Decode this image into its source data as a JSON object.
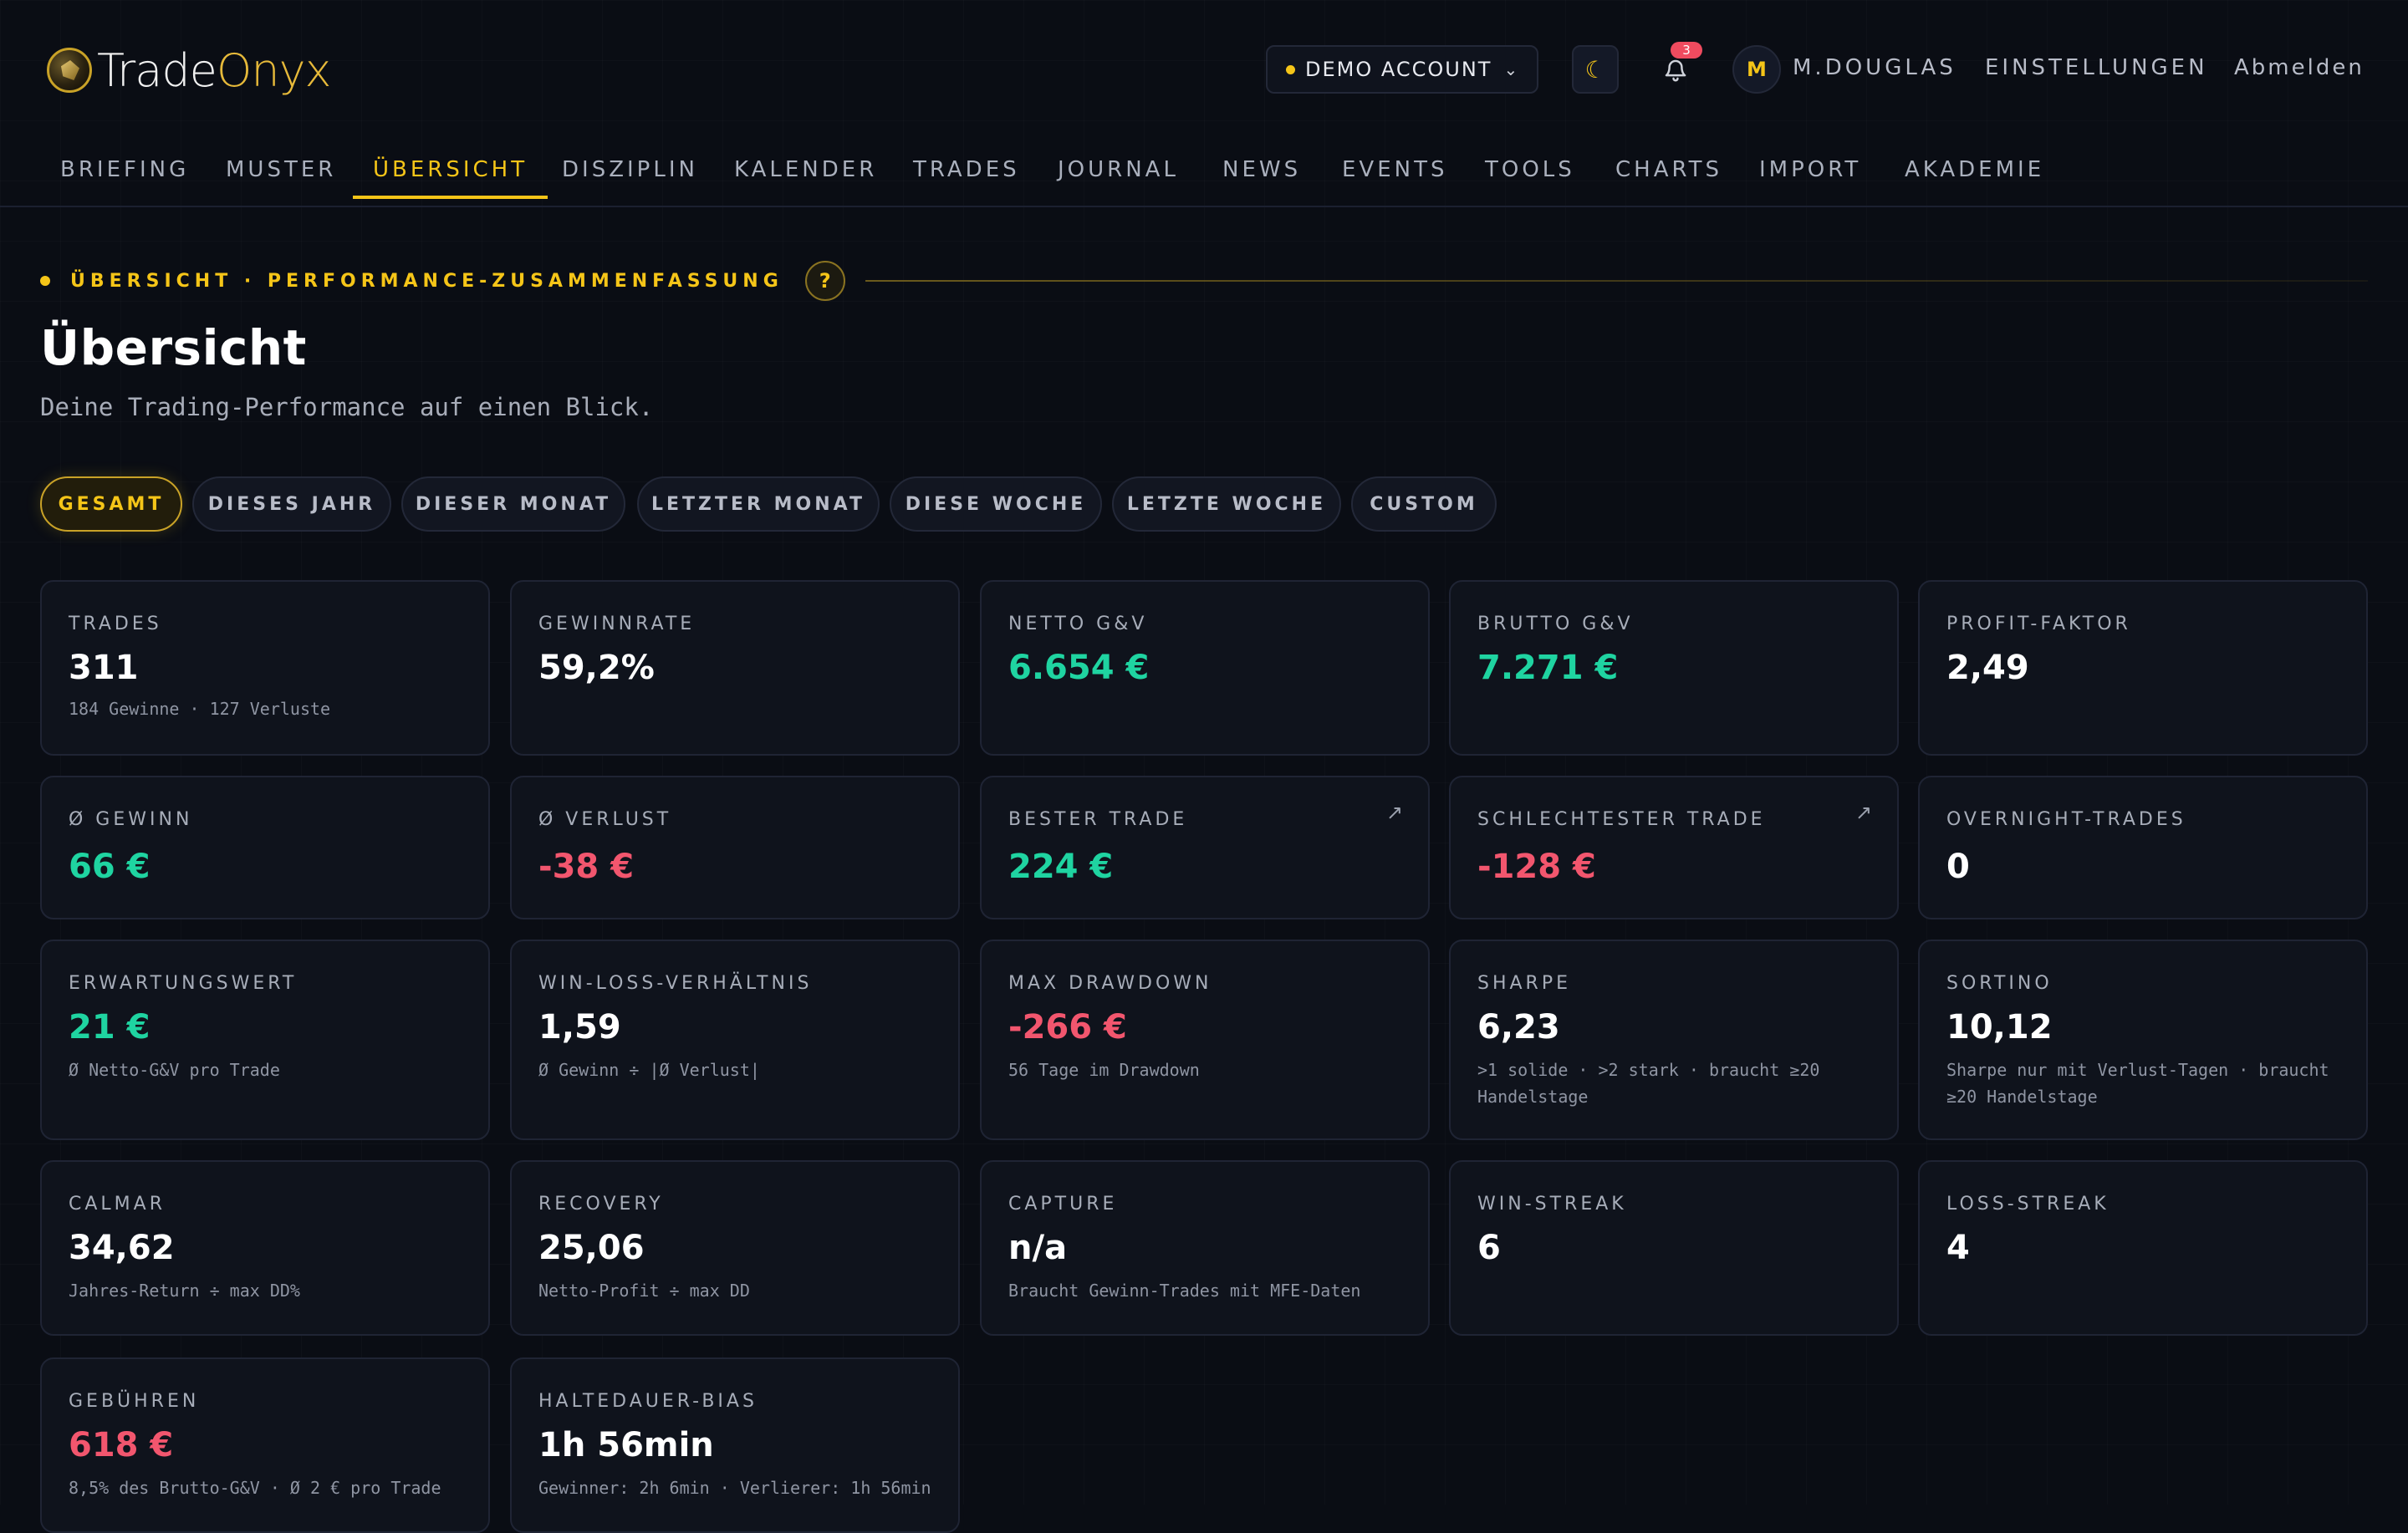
{
  "brand": {
    "name_a": "Trade",
    "name_b": "Onyx"
  },
  "header": {
    "account_label": "DEMO ACCOUNT",
    "notification_count": "3",
    "avatar_initial": "M",
    "user_name": "M.DOUGLAS",
    "settings_label": "EINSTELLUNGEN",
    "logout_label": "Abmelden"
  },
  "nav": {
    "tabs": [
      {
        "label": "BRIEFING"
      },
      {
        "label": "MUSTER"
      },
      {
        "label": "ÜBERSICHT"
      },
      {
        "label": "DISZIPLIN"
      },
      {
        "label": "KALENDER"
      },
      {
        "label": "TRADES"
      },
      {
        "label": "JOURNAL"
      },
      {
        "label": "NEWS"
      },
      {
        "label": "EVENTS"
      },
      {
        "label": "TOOLS"
      },
      {
        "label": "CHARTS"
      },
      {
        "label": "IMPORT"
      },
      {
        "label": "AKADEMIE"
      }
    ],
    "active": "ÜBERSICHT"
  },
  "page": {
    "eyebrow": "ÜBERSICHT · PERFORMANCE-ZUSAMMENFASSUNG",
    "help": "?",
    "title": "Übersicht",
    "subtitle": "Deine Trading-Performance auf einen Blick."
  },
  "filters": {
    "items": [
      {
        "label": "GESAMT"
      },
      {
        "label": "DIESES JAHR"
      },
      {
        "label": "DIESER MONAT"
      },
      {
        "label": "LETZTER MONAT"
      },
      {
        "label": "DIESE WOCHE"
      },
      {
        "label": "LETZTE WOCHE"
      },
      {
        "label": "CUSTOM"
      }
    ],
    "active": "GESAMT"
  },
  "cards": [
    {
      "label": "TRADES",
      "value": "311",
      "sub": "184 Gewinne · 127 Verluste",
      "tone": "neutral"
    },
    {
      "label": "GEWINNRATE",
      "value": "59,2%",
      "sub": "",
      "tone": "neutral"
    },
    {
      "label": "NETTO G&V",
      "value": "6.654 €",
      "sub": "",
      "tone": "pos"
    },
    {
      "label": "BRUTTO G&V",
      "value": "7.271 €",
      "sub": "",
      "tone": "pos"
    },
    {
      "label": "PROFIT-FAKTOR",
      "value": "2,49",
      "sub": "",
      "tone": "neutral"
    },
    {
      "label": "Ø GEWINN",
      "value": "66 €",
      "sub": "",
      "tone": "pos"
    },
    {
      "label": "Ø VERLUST",
      "value": "-38 €",
      "sub": "",
      "tone": "neg"
    },
    {
      "label": "BESTER TRADE",
      "value": "224 €",
      "sub": "",
      "tone": "pos",
      "link": "↗"
    },
    {
      "label": "SCHLECHTESTER TRADE",
      "value": "-128 €",
      "sub": "",
      "tone": "neg",
      "link": "↗"
    },
    {
      "label": "OVERNIGHT-TRADES",
      "value": "0",
      "sub": "",
      "tone": "neutral"
    },
    {
      "label": "ERWARTUNGSWERT",
      "value": "21 €",
      "sub": "Ø Netto-G&V pro Trade",
      "tone": "pos"
    },
    {
      "label": "WIN-LOSS-VERHÄLTNIS",
      "value": "1,59",
      "sub": "Ø Gewinn ÷ |Ø Verlust|",
      "tone": "neutral"
    },
    {
      "label": "MAX DRAWDOWN",
      "value": "-266 €",
      "sub": "56 Tage im Drawdown",
      "tone": "neg"
    },
    {
      "label": "SHARPE",
      "value": "6,23",
      "sub": ">1 solide · >2 stark · braucht ≥20 Handelstage",
      "tone": "neutral"
    },
    {
      "label": "SORTINO",
      "value": "10,12",
      "sub": "Sharpe nur mit Verlust-Tagen · braucht ≥20 Handelstage",
      "tone": "neutral"
    },
    {
      "label": "CALMAR",
      "value": "34,62",
      "sub": "Jahres-Return ÷ max DD%",
      "tone": "neutral"
    },
    {
      "label": "RECOVERY",
      "value": "25,06",
      "sub": "Netto-Profit ÷ max DD",
      "tone": "neutral"
    },
    {
      "label": "CAPTURE",
      "value": "n/a",
      "sub": "Braucht Gewinn-Trades mit MFE-Daten",
      "tone": "neutral"
    },
    {
      "label": "WIN-STREAK",
      "value": "6",
      "sub": "",
      "tone": "neutral"
    },
    {
      "label": "LOSS-STREAK",
      "value": "4",
      "sub": "",
      "tone": "neutral"
    },
    {
      "label": "GEBÜHREN",
      "value": "618 €",
      "sub": "8,5% des Brutto-G&V · Ø 2 € pro Trade",
      "tone": "neg"
    },
    {
      "label": "HALTEDAUER-BIAS",
      "value": "1h 56min",
      "sub": "Gewinner: 2h 6min · Verlierer: 1h 56min",
      "tone": "neutral"
    }
  ],
  "colors": {
    "accent": "#f5c518",
    "positive": "#1fd4a1",
    "negative": "#f2566e",
    "background": "#0a0d14",
    "card": "#0f131c"
  },
  "icons": {
    "moon": "moon-icon",
    "bell": "bell-icon",
    "chevron": "chevron-down-icon",
    "external": "arrow-up-right-icon"
  }
}
